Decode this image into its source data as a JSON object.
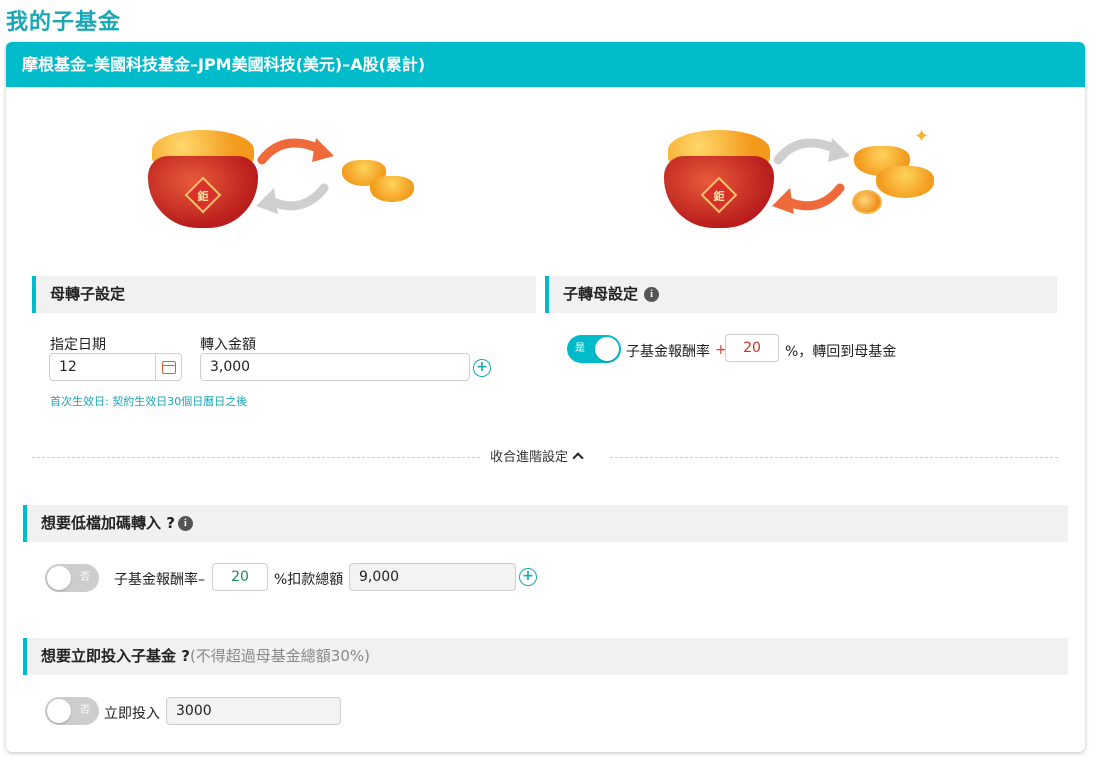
{
  "page": {
    "title": "我的子基金"
  },
  "fund": {
    "name": "摩根基金–美國科技基金–JPM美國科技(美元)–A股(累計)"
  },
  "illustrations": {
    "left": {
      "pot_char": "鉅",
      "icon": "gold-pot-to-ingots-exchange"
    },
    "right": {
      "pot_char": "鉅",
      "icon": "gold-pot-to-gold-pile-exchange"
    }
  },
  "parent_to_child": {
    "title": "母轉子設定",
    "date_label": "指定日期",
    "date_value": "12",
    "amount_label": "轉入金額",
    "amount_value": "3,000",
    "hint": "首次生效日: 契約生效日30個日曆日之後"
  },
  "child_to_parent": {
    "title": "子轉母設定",
    "toggle_label": "是",
    "toggle_on": true,
    "rate_label": "子基金報酬率",
    "sign": "+",
    "rate_value": "20",
    "suffix": "%，轉回到母基金"
  },
  "collapse": {
    "label": "收合進階設定"
  },
  "low_buy": {
    "title": "想要低檔加碼轉入 ?",
    "toggle_label": "否",
    "toggle_on": false,
    "rate_label": "子基金報酬率–",
    "rate_value": "20",
    "total_label": "%扣款總額",
    "total_value": "9,000"
  },
  "invest_now": {
    "title": "想要立即投入子基金 ?",
    "note": "(不得超過母基金總額30%)",
    "toggle_label": "否",
    "toggle_on": false,
    "label": "立即投入",
    "value": "3000"
  },
  "colors": {
    "accent": "#00bccb",
    "title": "#1aa7b5",
    "arrow": "#ee6a3a",
    "gray_arrow": "#cfcfcf"
  }
}
